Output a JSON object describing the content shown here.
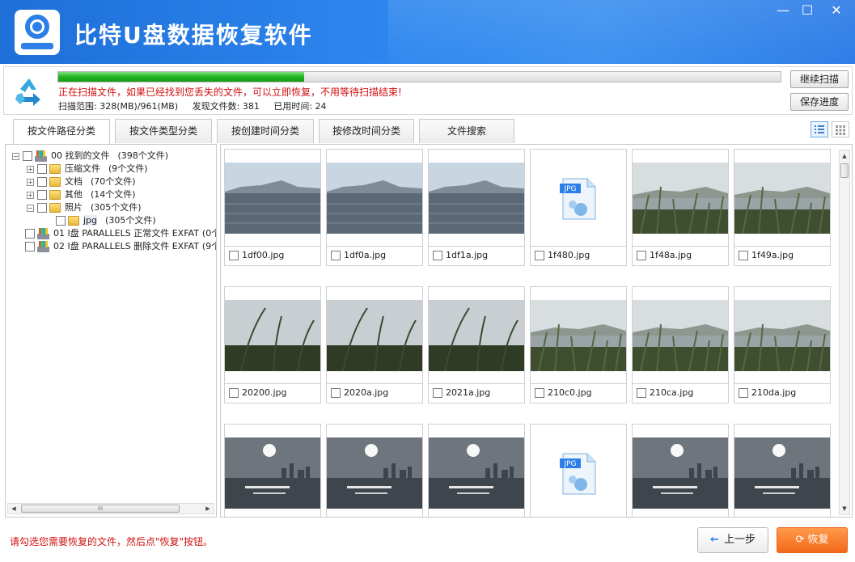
{
  "window": {
    "title": "比特U盘数据恢复软件",
    "minimize": "—",
    "maximize": "☐",
    "close": "✕"
  },
  "scan": {
    "progress_percent": 34,
    "message": "正在扫描文件，如果已经找到您丢失的文件，可以立即恢复，不用等待扫描结束!",
    "range": "扫描范围: 328(MB)/961(MB)",
    "found": "发现文件数: 381",
    "elapsed": "已用时间: 24",
    "continue_label": "继续扫描",
    "save_label": "保存进度"
  },
  "tabs": [
    {
      "label": "按文件路径分类"
    },
    {
      "label": "按文件类型分类"
    },
    {
      "label": "按创建时间分类"
    },
    {
      "label": "按修改时间分类"
    },
    {
      "label": "文件搜索"
    }
  ],
  "tree": [
    {
      "label": "00 找到的文件",
      "count": "(398个文件)"
    },
    {
      "label": "压缩文件",
      "count": "(9个文件)"
    },
    {
      "label": "文档",
      "count": "(70个文件)"
    },
    {
      "label": "其他",
      "count": "(14个文件)"
    },
    {
      "label": "照片",
      "count": "(305个文件)"
    },
    {
      "label": "jpg",
      "count": "(305个文件)"
    },
    {
      "label": "01 I盘 PARALLELS 正常文件 EXFAT",
      "count": "(0个"
    },
    {
      "label": "02 I盘 PARALLELS 删除文件 EXFAT",
      "count": "(9个"
    }
  ],
  "scroll_grip": "III",
  "files": [
    {
      "name": "1df00.jpg",
      "kind": "lake"
    },
    {
      "name": "1df0a.jpg",
      "kind": "lake"
    },
    {
      "name": "1df1a.jpg",
      "kind": "lake"
    },
    {
      "name": "1f480.jpg",
      "kind": "jpg-icon"
    },
    {
      "name": "1f48a.jpg",
      "kind": "grass-lake"
    },
    {
      "name": "1f49a.jpg",
      "kind": "grass-lake"
    },
    {
      "name": "20200.jpg",
      "kind": "grass-sky"
    },
    {
      "name": "2020a.jpg",
      "kind": "grass-sky"
    },
    {
      "name": "2021a.jpg",
      "kind": "grass-sky"
    },
    {
      "name": "210c0.jpg",
      "kind": "grass-lake"
    },
    {
      "name": "210ca.jpg",
      "kind": "grass-lake"
    },
    {
      "name": "210da.jpg",
      "kind": "grass-lake"
    },
    {
      "name": "",
      "kind": "city-sun"
    },
    {
      "name": "",
      "kind": "city-sun"
    },
    {
      "name": "",
      "kind": "city-sun"
    },
    {
      "name": "",
      "kind": "jpg-icon"
    },
    {
      "name": "",
      "kind": "city-sun"
    },
    {
      "name": "",
      "kind": "city-sun"
    }
  ],
  "jpg_badge": "JPG",
  "footer": {
    "hint": "请勾选您需要恢复的文件，然后点\"恢复\"按钮。",
    "back_label": "上一步",
    "restore_label": "恢复"
  },
  "colors": {
    "titlebar": "#2d86ee",
    "progress": "#22b322",
    "hint": "#d01010",
    "restore": "#f26a1a"
  }
}
